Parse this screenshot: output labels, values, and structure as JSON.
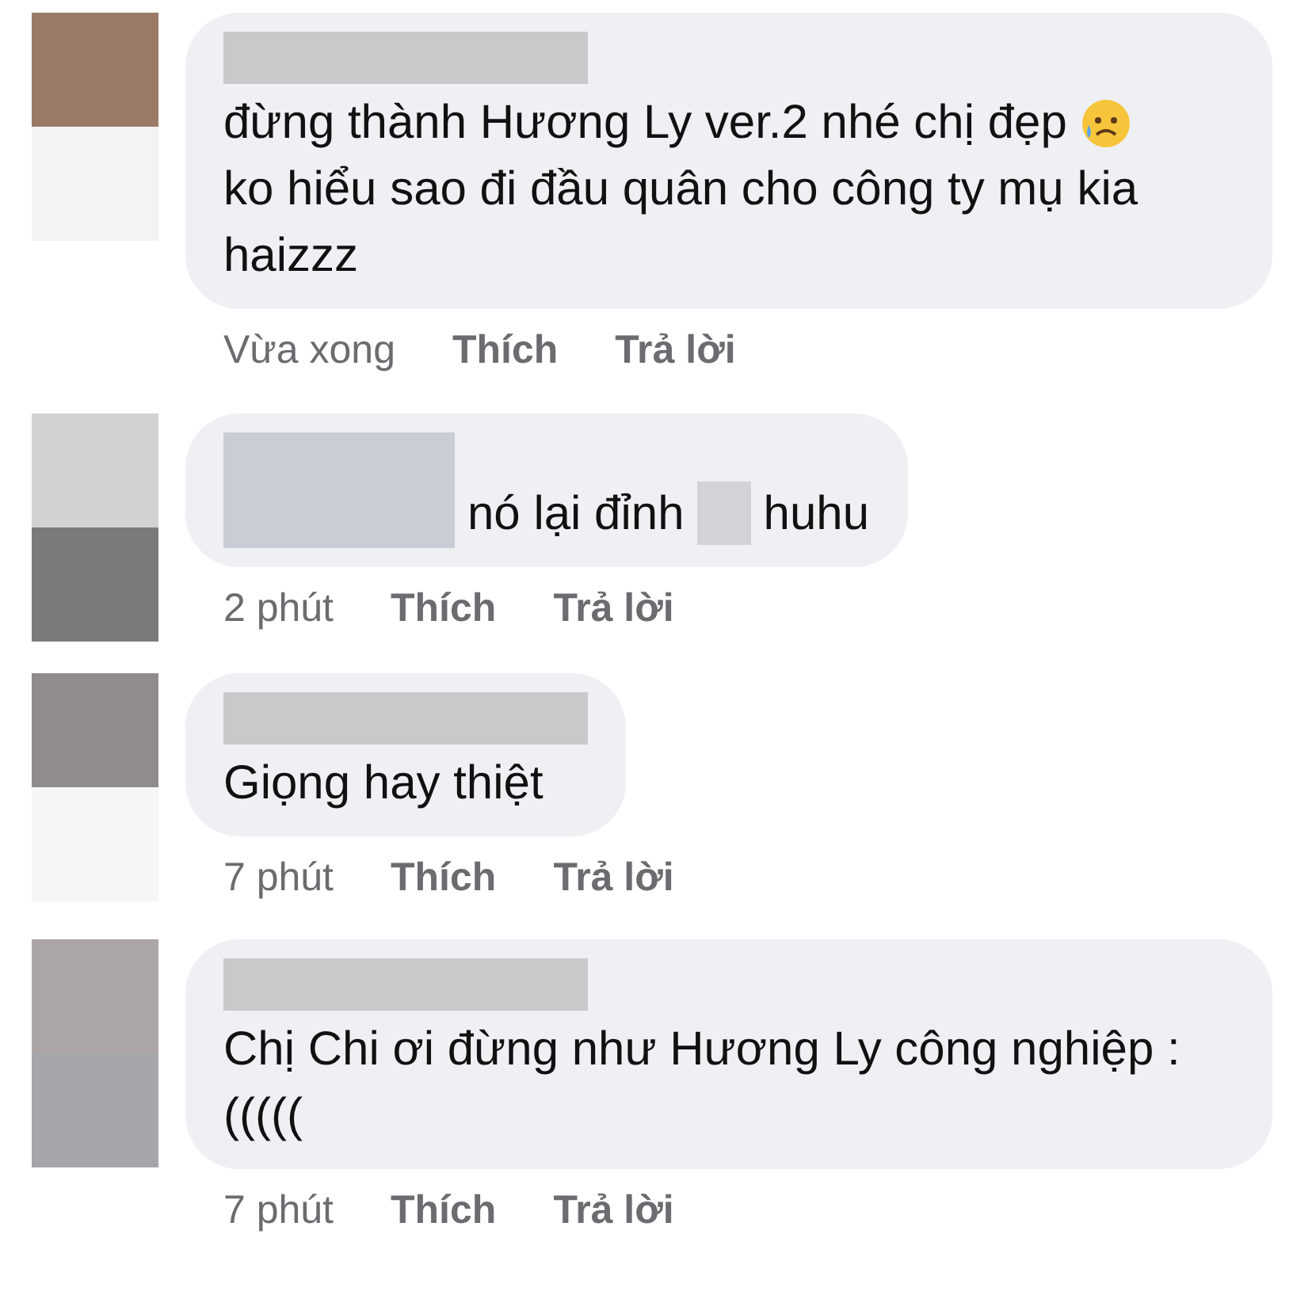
{
  "comments": [
    {
      "kind": "stacked",
      "lines": [
        [
          {
            "kind": "text",
            "text": "đừng thành Hương Ly ver.2 nhé chị đẹp"
          },
          {
            "kind": "emoji"
          }
        ],
        [
          {
            "kind": "text",
            "text": "ko hiểu sao đi đầu quân cho công ty mụ kia haizzz"
          }
        ]
      ],
      "time": "Vừa xong",
      "like": "Thích",
      "reply": "Trả lời"
    },
    {
      "kind": "inline",
      "lines": [
        [
          {
            "kind": "text",
            "text": "nó lại đỉnh"
          },
          {
            "kind": "redacted"
          },
          {
            "kind": "text",
            "text": "huhu"
          }
        ]
      ],
      "time": "2 phút",
      "like": "Thích",
      "reply": "Trả lời"
    },
    {
      "kind": "stacked",
      "lines": [
        [
          {
            "kind": "text",
            "text": "Giọng hay thiệt"
          }
        ]
      ],
      "time": "7 phút",
      "like": "Thích",
      "reply": "Trả lời"
    },
    {
      "kind": "stacked",
      "lines": [
        [
          {
            "kind": "text",
            "text": "Chị Chi ơi đừng như Hương Ly công nghiệp : ((((("
          }
        ]
      ],
      "time": "7 phút",
      "like": "Thích",
      "reply": "Trả lời"
    }
  ]
}
